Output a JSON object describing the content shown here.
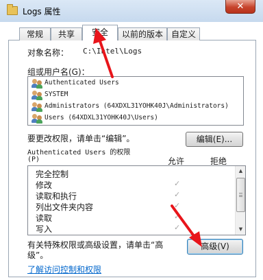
{
  "window": {
    "title": "Logs 属性",
    "close_icon": "close-icon"
  },
  "tabs": [
    {
      "label": "常规",
      "active": false
    },
    {
      "label": "共享",
      "active": false
    },
    {
      "label": "安全",
      "active": true
    },
    {
      "label": "以前的版本",
      "active": false
    },
    {
      "label": "自定义",
      "active": false
    }
  ],
  "security": {
    "object_name_label": "对象名称：",
    "object_name_value": "C:\\Intel\\Logs",
    "group_label": "组或用户名(G)：",
    "users": [
      {
        "name": "Authenticated Users",
        "icon": "users-icon"
      },
      {
        "name": "SYSTEM",
        "icon": "users-icon"
      },
      {
        "name": "Administrators (64XDXL31YOHK40J\\Administrators)",
        "icon": "users-icon"
      },
      {
        "name": "Users (64XDXL31YOHK40J\\Users)",
        "icon": "users-icon"
      }
    ],
    "change_perm_text": "要更改权限，请单击“编辑”。",
    "edit_button": "编辑(E)...",
    "perm_for_label": "Authenticated Users 的权限",
    "perm_for_paren": "(P)",
    "col_allow": "允许",
    "col_deny": "拒绝",
    "permissions": [
      {
        "name": "完全控制",
        "allow": false
      },
      {
        "name": "修改",
        "allow": true
      },
      {
        "name": "读取和执行",
        "allow": true
      },
      {
        "name": "列出文件夹内容",
        "allow": true
      },
      {
        "name": "读取",
        "allow": true
      },
      {
        "name": "写入",
        "allow": true
      }
    ],
    "check_mark": "✓",
    "advanced_text": "有关特殊权限或高级设置，请单击“高级”。",
    "advanced_button": "高级(V)",
    "learn_link": "了解访问控制和权限"
  },
  "colors": {
    "annotation_arrow": "#e8151b",
    "link": "#0066cc"
  }
}
